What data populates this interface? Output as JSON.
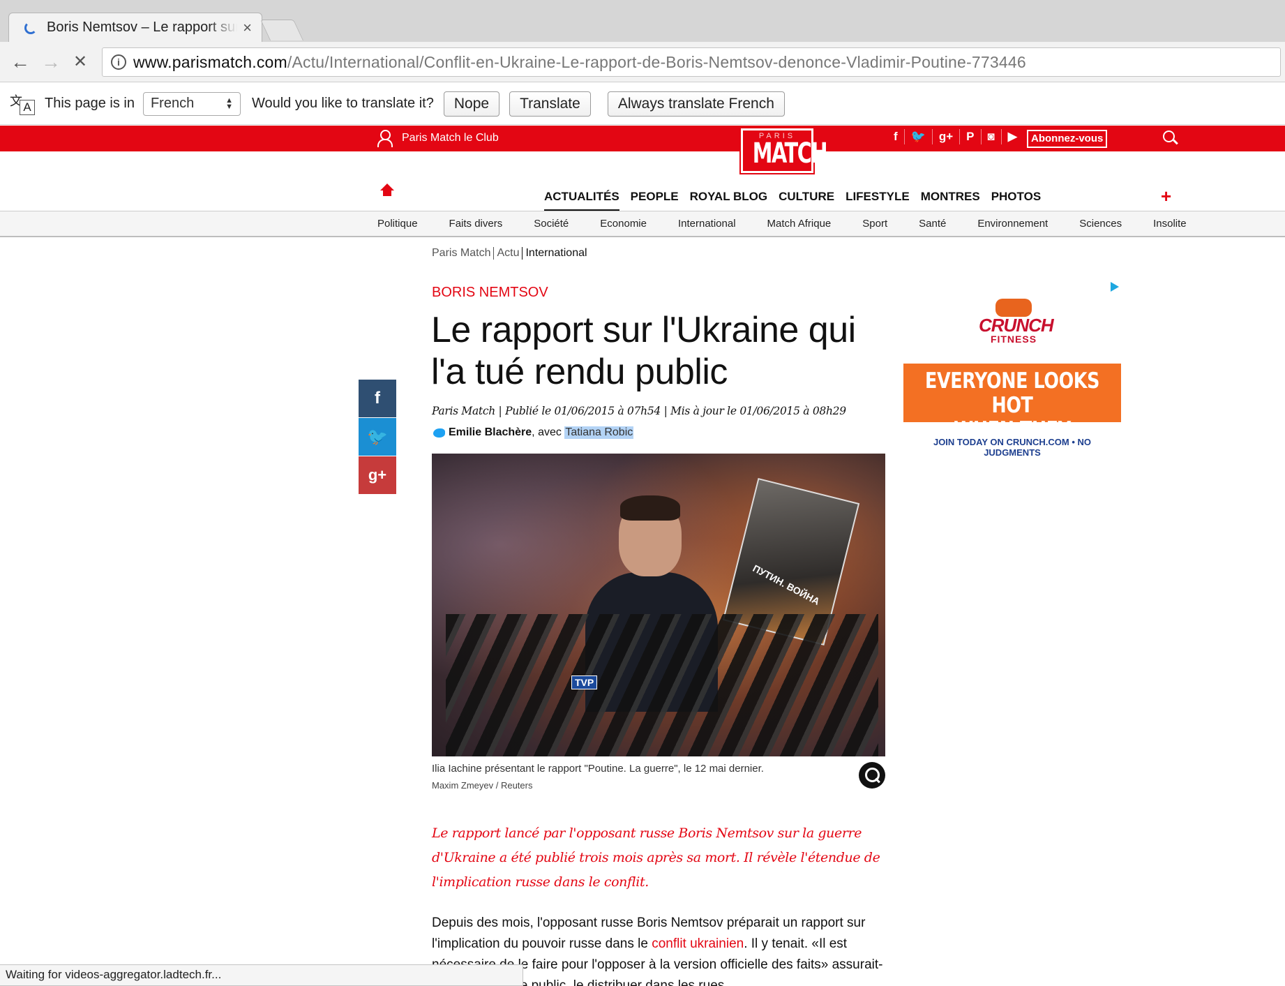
{
  "browser": {
    "tab_title": "Boris Nemtsov – Le rapport sur l'Ukraine",
    "tab_close": "×",
    "url_host": "www.parismatch.com",
    "url_path": "/Actu/International/Conflit-en-Ukraine-Le-rapport-de-Boris-Nemtsov-denonce-Vladimir-Poutine-773446",
    "back": "←",
    "forward": "→",
    "stop": "✕",
    "status": "Waiting for videos-aggregator.ladtech.fr..."
  },
  "translate_bar": {
    "icon_a": "文",
    "icon_b": "A",
    "prefix": "This page is in",
    "language": "French",
    "question": "Would you like to translate it?",
    "nope": "Nope",
    "translate": "Translate",
    "always": "Always translate French"
  },
  "site": {
    "club": "Paris Match le Club",
    "logo_top": "PARIS",
    "logo_main": "MATCH",
    "socials": [
      "f",
      "🐦",
      "g+",
      "P",
      "◙",
      "▶"
    ],
    "subscribe": "Abonnez-vous",
    "nav": [
      "ACTUALITÉS",
      "PEOPLE",
      "ROYAL BLOG",
      "CULTURE",
      "LIFESTYLE",
      "MONTRES",
      "PHOTOS"
    ],
    "plus": "+",
    "subnav": [
      "Politique",
      "Faits divers",
      "Société",
      "Economie",
      "International",
      "Match Afrique",
      "Sport",
      "Santé",
      "Environnement",
      "Sciences",
      "Insolite"
    ]
  },
  "article": {
    "breadcrumb": [
      "Paris Match",
      "Actu",
      "International"
    ],
    "kicker": "BORIS NEMTSOV",
    "headline": "Le rapport sur l'Ukraine qui l'a tué rendu public",
    "meta": "Paris Match | Publié le 01/06/2015 à 07h54 | Mis à jour le 01/06/2015 à 08h29",
    "author1": "Emilie Blachère",
    "author_sep": ", avec ",
    "author2": "Tatiana Robic",
    "share": {
      "facebook": "f",
      "twitter": "🐦",
      "gplus": "g+"
    },
    "photo_mic_label": "TVP",
    "photo_book_text": "ПУТИН. ВОЙНА",
    "caption": "Ilia Iachine présentant le rapport \"Poutine. La guerre\", le 12 mai dernier.",
    "credit": "Maxim Zmeyev / Reuters",
    "chapo": "Le rapport lancé par l'opposant russe Boris Nemtsov sur la guerre d'Ukraine a été publié trois mois après sa mort. Il révèle l'étendue de l'implication russe dans le conflit.",
    "body_1": "Depuis des mois, l'opposant russe Boris Nemtsov préparait un rapport sur l'implication du pouvoir russe dans le ",
    "body_link": "conflit ukrainien",
    "body_2": ". Il y tenait. «Il est nécessaire de le faire pour l'opposer à la version officielle des",
    "body_3": "faits» assurait-il, pour le rendre public, le distribuer dans les rues..."
  },
  "ad": {
    "brand": "CRUNCH",
    "brand_sub": "FITNESS",
    "line1": "EVERYONE LOOKS HOT",
    "line2": "WHEN THEY SWEAT",
    "tagline": "JOIN TODAY ON CRUNCH.COM • NO JUDGMENTS"
  },
  "colors": {
    "brand_red": "#e30613",
    "ad_orange": "#f37023"
  }
}
